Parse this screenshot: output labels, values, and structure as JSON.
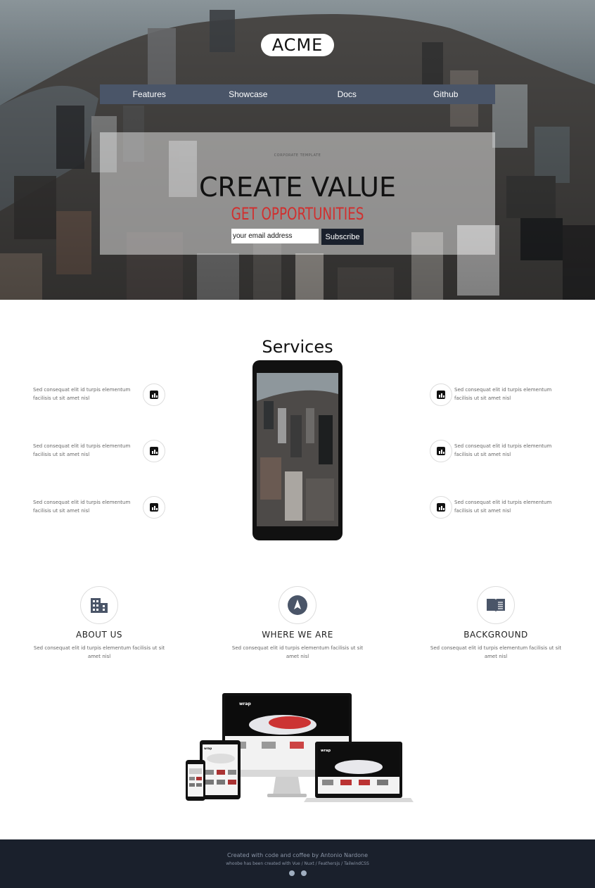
{
  "brand": {
    "logo": "ACME"
  },
  "nav": {
    "items": [
      "Features",
      "Showcase",
      "Docs",
      "Github"
    ]
  },
  "hero": {
    "kicker": "CORPORATE TEMPLATE",
    "headline": "CREATE VALUE",
    "subheadline": "GET OPPORTUNITIES",
    "email_placeholder": "your email address",
    "subscribe_label": "Subscribe"
  },
  "services": {
    "title": "Services",
    "features_left": [
      "Sed consequat elit id turpis elementum facilisis ut sit amet nisl",
      "Sed consequat elit id turpis elementum facilisis ut sit amet nisl",
      "Sed consequat elit id turpis elementum facilisis ut sit amet nisl"
    ],
    "features_right": [
      "Sed consequat elit id turpis elementum facilisis ut sit amet nisl",
      "Sed consequat elit id turpis elementum facilisis ut sit amet nisl",
      "Sed consequat elit id turpis elementum facilisis ut sit amet nisl"
    ],
    "feature_icon": "bar-chart-icon"
  },
  "info": [
    {
      "icon": "building-icon",
      "title": "ABOUT US",
      "text": "Sed consequat elit id turpis elementum facilisis ut sit amet nisl"
    },
    {
      "icon": "navigation-icon",
      "title": "WHERE WE ARE",
      "text": "Sed consequat elit id turpis elementum facilisis ut sit amet nisl"
    },
    {
      "icon": "book-icon",
      "title": "BACKGROUND",
      "text": "Sed consequat elit id turpis elementum facilisis ut sit amet nisl"
    }
  ],
  "showcase": {
    "brand_on_screens": "wrap"
  },
  "footer": {
    "credit": "Created with code and coffee by Antonio Nardone",
    "tech": "whoobe has been created with Vue / Nuxt / Feathersjs / TailwindCSS",
    "icons": [
      "github-icon",
      "help-icon"
    ]
  },
  "colors": {
    "nav_bg": "#4a5568",
    "accent_red": "#d0302f",
    "footer_bg": "#1a202c",
    "button_bg": "#1a202c"
  }
}
